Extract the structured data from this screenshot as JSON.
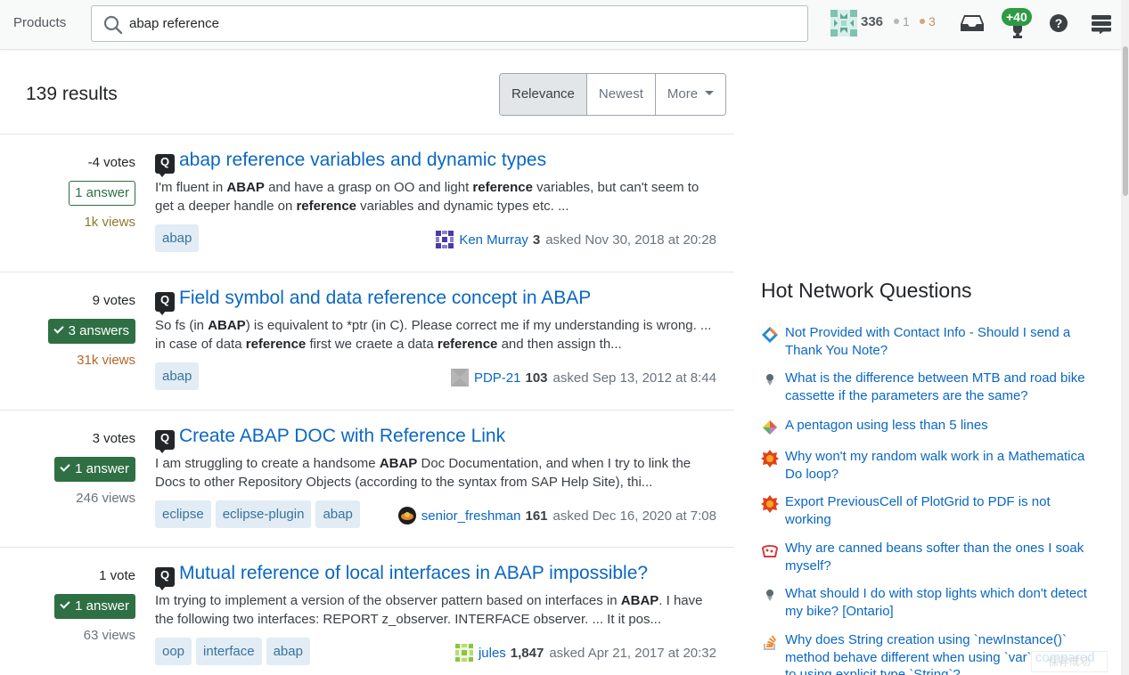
{
  "header": {
    "products_label": "Products",
    "search_value": "abap reference",
    "reputation": "336",
    "silver_badges": "1",
    "bronze_badges": "3",
    "achievement_count": "+40"
  },
  "results": {
    "count_label": "139 results",
    "sort_options": [
      "Relevance",
      "Newest",
      "More"
    ]
  },
  "questions": [
    {
      "votes": "-4 votes",
      "answers": "1 answer",
      "answers_accepted": false,
      "views": "1k views",
      "views_color": "#8f7a2a",
      "title": "abap reference variables and dynamic types",
      "excerpt_html": "I'm fluent in <b>ABAP</b> and have a grasp on OO and light <b>reference</b> variables, but can't seem to get a deeper handle on <b>reference</b> variables and dynamic types etc. ...",
      "tags": [
        "abap"
      ],
      "user": "Ken Murray",
      "user_rep": "3",
      "asked": "asked Nov 30, 2018 at 20:28"
    },
    {
      "votes": "9 votes",
      "answers": "3 answers",
      "answers_accepted": true,
      "views": "31k views",
      "views_color": "#b5662c",
      "title": "Field symbol and data reference concept in ABAP",
      "excerpt_html": "So fs (in <b>ABAP</b>) is equivalent to *ptr (in C). Please correct me if my understanding is wrong. ... in case of data <b>reference</b> first we craete a data <b>reference</b> and then assign th...",
      "tags": [
        "abap"
      ],
      "user": "PDP-21",
      "user_rep": "103",
      "asked": "asked Sep 13, 2012 at 8:44"
    },
    {
      "votes": "3 votes",
      "answers": "1 answer",
      "answers_accepted": true,
      "views": "246 views",
      "views_color": "#6a737c",
      "title": "Create ABAP DOC with Reference Link",
      "excerpt_html": "I am struggling to create a handsome <b>ABAP</b> Doc Documentation, and when I try to link the Docs to other Repository Objects (according to the syntax from SAP Help Site), thi...",
      "tags": [
        "eclipse",
        "eclipse-plugin",
        "abap"
      ],
      "user": "senior_freshman",
      "user_rep": "161",
      "asked": "asked Dec 16, 2020 at 7:08"
    },
    {
      "votes": "1 vote",
      "answers": "1 answer",
      "answers_accepted": true,
      "views": "63 views",
      "views_color": "#6a737c",
      "title": "Mutual reference of local interfaces in ABAP impossible?",
      "excerpt_html": "Im trying to implement a version of the observer pattern based on interfaces in <b>ABAP</b>. I have the following two interfaces: REPORT z_observer. INTERFACE observer. ... It it pos...",
      "tags": [
        "oop",
        "interface",
        "abap"
      ],
      "user": "jules",
      "user_rep": "1,847",
      "asked": "asked Apr 21, 2017 at 20:32"
    }
  ],
  "sidebar": {
    "hot_network_title": "Hot Network Questions",
    "hot_network_questions": [
      {
        "text": "Not Provided with Contact Info - Should I send a Thank You Note?",
        "icon": "workplace-icon"
      },
      {
        "text": "What is the difference between MTB and road bike cassette if the parameters are the same?",
        "icon": "bicycles-icon"
      },
      {
        "text": "A pentagon using less than 5 lines",
        "icon": "puzzling-icon"
      },
      {
        "text": "Why won't my random walk work in a Mathematica Do loop?",
        "icon": "mathematica-icon"
      },
      {
        "text": "Export PreviousCell of PlotGrid to PDF is not working",
        "icon": "mathematica-icon"
      },
      {
        "text": "Why are canned beans softer than the ones I soak myself?",
        "icon": "cooking-icon"
      },
      {
        "text": "What should I do with stop lights which don't detect my bike? [Ontario]",
        "icon": "bicycles-icon"
      },
      {
        "text": "Why does String creation using `newInstance()` method behave different when using `var` compared to using explicit type `String`?",
        "icon": "stackoverflow-icon"
      }
    ]
  },
  "overlay": {
    "toast_text": "保存成功"
  },
  "colors": {
    "link": "#0a67c2",
    "accepted_green": "#2f6f44",
    "tag_bg": "#e1ecf4",
    "tag_fg": "#39739d"
  }
}
